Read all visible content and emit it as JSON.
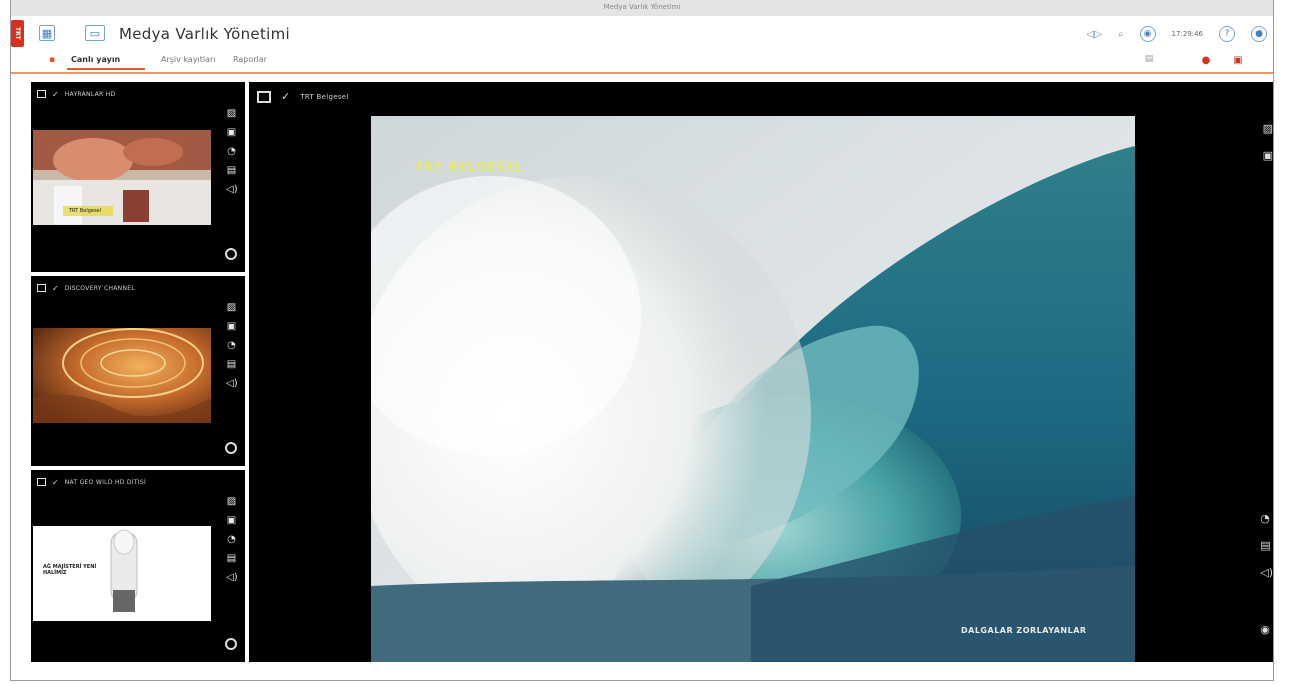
{
  "window": {
    "title": "Medya Varlık Yönetimi"
  },
  "app": {
    "logo_text": "TRT",
    "title": "Medya Varlık Yönetimi",
    "clock": "17:29:46",
    "help_label": "?",
    "icons": [
      "grid-icon",
      "monitor-icon",
      "speaker-icon",
      "search-icon",
      "record-icon",
      "help-icon",
      "power-icon"
    ]
  },
  "tabs": [
    {
      "label": "Canlı yayın",
      "active": true
    },
    {
      "label": "Arşiv kayıtları",
      "active": false
    },
    {
      "label": "Raporlar",
      "active": false
    }
  ],
  "channels": [
    {
      "name": "HAYRANLAR HD",
      "thumb_caption": "TRT Belgesel"
    },
    {
      "name": "DISCOVERY CHANNEL",
      "thumb_caption": ""
    },
    {
      "name": "NAT GEO WILD HD DİTİSİ",
      "thumb_caption": "AĞ MAJİSTERİ YENİ HALİMİZ"
    }
  ],
  "main_player": {
    "channel_name": "TRT Belgesel",
    "watermark": "TRT BELGESEL",
    "lower_caption": "DALGALAR ZORLAYANLAR"
  },
  "colors": {
    "accent": "#e0592a",
    "brand": "#d6301f",
    "link": "#3a7fc4"
  }
}
